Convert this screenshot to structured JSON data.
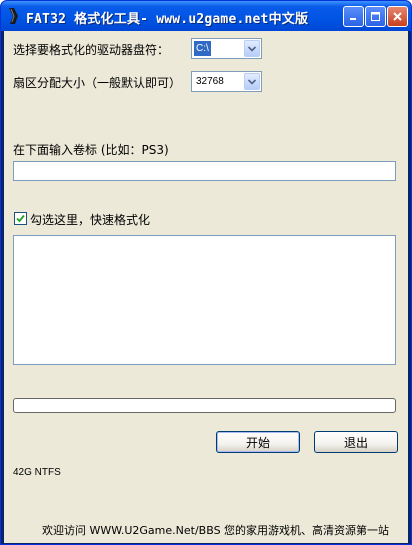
{
  "window": {
    "title": "FAT32 格式化工具- www.u2game.net中文版"
  },
  "drive": {
    "label": "选择要格式化的驱动器盘符：",
    "selected": "C:\\"
  },
  "cluster": {
    "label": "扇区分配大小（一般默认即可）",
    "selected": "32768"
  },
  "volume": {
    "label": "在下面输入卷标 (比如：PS3)",
    "value": ""
  },
  "quick_format": {
    "label": "勾选这里，快速格式化",
    "checked": true
  },
  "log": {
    "text": ""
  },
  "progress": {
    "percent": 0
  },
  "buttons": {
    "start": "开始",
    "exit": "退出"
  },
  "status": {
    "text": "42G NTFS"
  },
  "footer": {
    "text": "欢迎访问 WWW.U2Game.Net/BBS 您的家用游戏机、高清资源第一站"
  },
  "icons": [
    "app-icon",
    "minimize-icon",
    "maximize-icon",
    "close-icon",
    "dropdown-arrow-icon",
    "checkmark-icon"
  ]
}
